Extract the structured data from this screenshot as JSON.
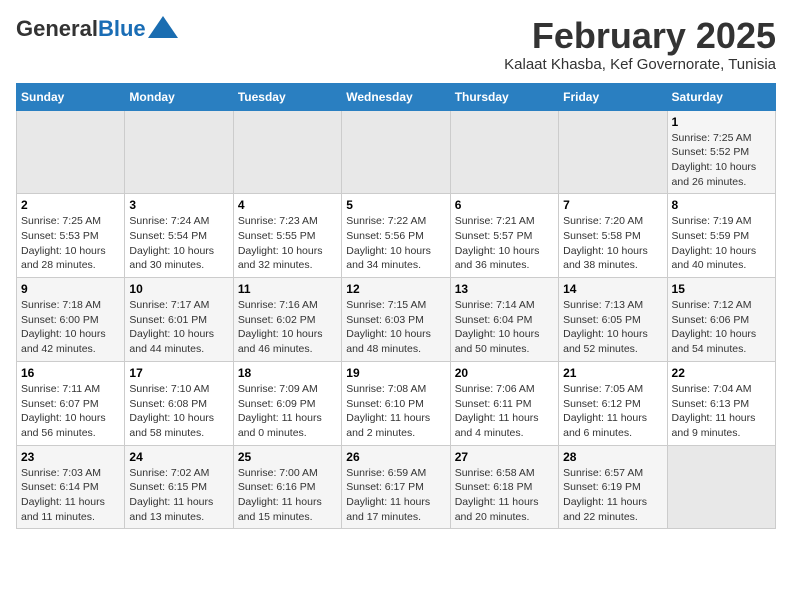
{
  "header": {
    "logo_general": "General",
    "logo_blue": "Blue",
    "title": "February 2025",
    "subtitle": "Kalaat Khasba, Kef Governorate, Tunisia"
  },
  "days_of_week": [
    "Sunday",
    "Monday",
    "Tuesday",
    "Wednesday",
    "Thursday",
    "Friday",
    "Saturday"
  ],
  "weeks": [
    [
      {
        "day": "",
        "info": ""
      },
      {
        "day": "",
        "info": ""
      },
      {
        "day": "",
        "info": ""
      },
      {
        "day": "",
        "info": ""
      },
      {
        "day": "",
        "info": ""
      },
      {
        "day": "",
        "info": ""
      },
      {
        "day": "1",
        "info": "Sunrise: 7:25 AM\nSunset: 5:52 PM\nDaylight: 10 hours and 26 minutes."
      }
    ],
    [
      {
        "day": "2",
        "info": "Sunrise: 7:25 AM\nSunset: 5:53 PM\nDaylight: 10 hours and 28 minutes."
      },
      {
        "day": "3",
        "info": "Sunrise: 7:24 AM\nSunset: 5:54 PM\nDaylight: 10 hours and 30 minutes."
      },
      {
        "day": "4",
        "info": "Sunrise: 7:23 AM\nSunset: 5:55 PM\nDaylight: 10 hours and 32 minutes."
      },
      {
        "day": "5",
        "info": "Sunrise: 7:22 AM\nSunset: 5:56 PM\nDaylight: 10 hours and 34 minutes."
      },
      {
        "day": "6",
        "info": "Sunrise: 7:21 AM\nSunset: 5:57 PM\nDaylight: 10 hours and 36 minutes."
      },
      {
        "day": "7",
        "info": "Sunrise: 7:20 AM\nSunset: 5:58 PM\nDaylight: 10 hours and 38 minutes."
      },
      {
        "day": "8",
        "info": "Sunrise: 7:19 AM\nSunset: 5:59 PM\nDaylight: 10 hours and 40 minutes."
      }
    ],
    [
      {
        "day": "9",
        "info": "Sunrise: 7:18 AM\nSunset: 6:00 PM\nDaylight: 10 hours and 42 minutes."
      },
      {
        "day": "10",
        "info": "Sunrise: 7:17 AM\nSunset: 6:01 PM\nDaylight: 10 hours and 44 minutes."
      },
      {
        "day": "11",
        "info": "Sunrise: 7:16 AM\nSunset: 6:02 PM\nDaylight: 10 hours and 46 minutes."
      },
      {
        "day": "12",
        "info": "Sunrise: 7:15 AM\nSunset: 6:03 PM\nDaylight: 10 hours and 48 minutes."
      },
      {
        "day": "13",
        "info": "Sunrise: 7:14 AM\nSunset: 6:04 PM\nDaylight: 10 hours and 50 minutes."
      },
      {
        "day": "14",
        "info": "Sunrise: 7:13 AM\nSunset: 6:05 PM\nDaylight: 10 hours and 52 minutes."
      },
      {
        "day": "15",
        "info": "Sunrise: 7:12 AM\nSunset: 6:06 PM\nDaylight: 10 hours and 54 minutes."
      }
    ],
    [
      {
        "day": "16",
        "info": "Sunrise: 7:11 AM\nSunset: 6:07 PM\nDaylight: 10 hours and 56 minutes."
      },
      {
        "day": "17",
        "info": "Sunrise: 7:10 AM\nSunset: 6:08 PM\nDaylight: 10 hours and 58 minutes."
      },
      {
        "day": "18",
        "info": "Sunrise: 7:09 AM\nSunset: 6:09 PM\nDaylight: 11 hours and 0 minutes."
      },
      {
        "day": "19",
        "info": "Sunrise: 7:08 AM\nSunset: 6:10 PM\nDaylight: 11 hours and 2 minutes."
      },
      {
        "day": "20",
        "info": "Sunrise: 7:06 AM\nSunset: 6:11 PM\nDaylight: 11 hours and 4 minutes."
      },
      {
        "day": "21",
        "info": "Sunrise: 7:05 AM\nSunset: 6:12 PM\nDaylight: 11 hours and 6 minutes."
      },
      {
        "day": "22",
        "info": "Sunrise: 7:04 AM\nSunset: 6:13 PM\nDaylight: 11 hours and 9 minutes."
      }
    ],
    [
      {
        "day": "23",
        "info": "Sunrise: 7:03 AM\nSunset: 6:14 PM\nDaylight: 11 hours and 11 minutes."
      },
      {
        "day": "24",
        "info": "Sunrise: 7:02 AM\nSunset: 6:15 PM\nDaylight: 11 hours and 13 minutes."
      },
      {
        "day": "25",
        "info": "Sunrise: 7:00 AM\nSunset: 6:16 PM\nDaylight: 11 hours and 15 minutes."
      },
      {
        "day": "26",
        "info": "Sunrise: 6:59 AM\nSunset: 6:17 PM\nDaylight: 11 hours and 17 minutes."
      },
      {
        "day": "27",
        "info": "Sunrise: 6:58 AM\nSunset: 6:18 PM\nDaylight: 11 hours and 20 minutes."
      },
      {
        "day": "28",
        "info": "Sunrise: 6:57 AM\nSunset: 6:19 PM\nDaylight: 11 hours and 22 minutes."
      },
      {
        "day": "",
        "info": ""
      }
    ]
  ]
}
